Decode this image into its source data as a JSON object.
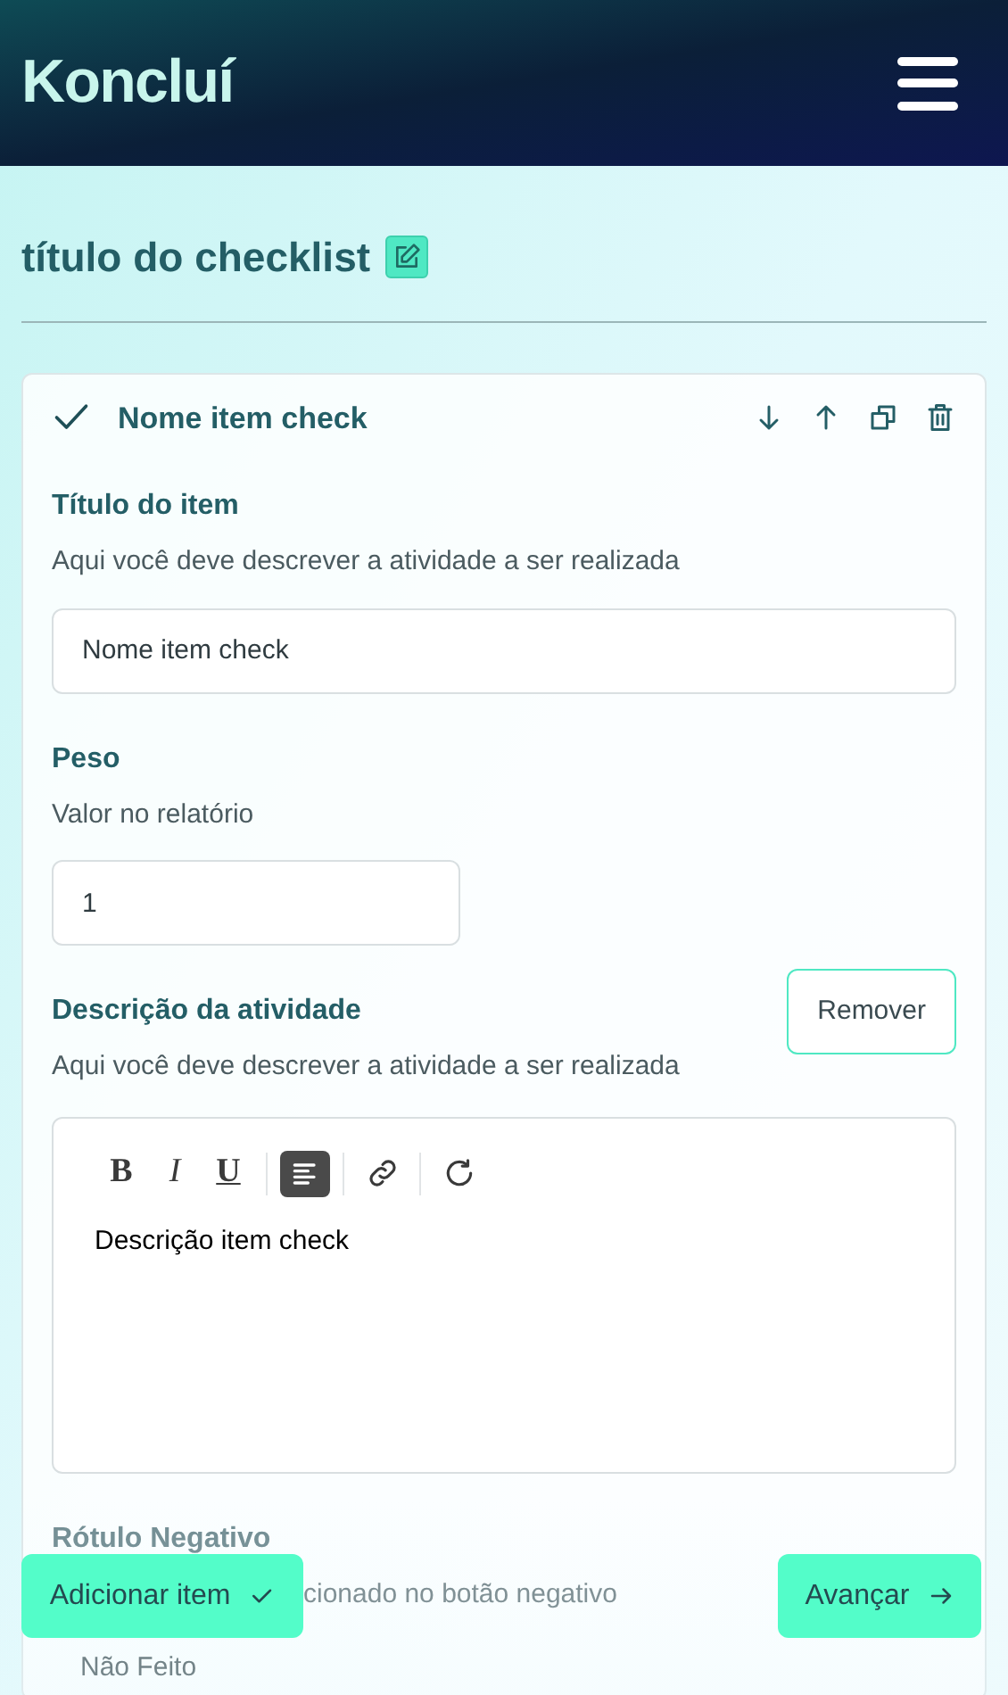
{
  "header": {
    "logo": "Koncluí"
  },
  "page_title": "título do checklist",
  "item": {
    "checked": true,
    "name": "Nome item check",
    "fields": [
      {
        "kind": "text",
        "label": "Título do item",
        "hint": "Aqui você deve descrever a atividade a ser realizada",
        "value": "Nome item check"
      },
      {
        "kind": "number",
        "label": "Peso",
        "hint": "Valor no relatório",
        "value": "1"
      },
      {
        "kind": "editor",
        "label": "Descrição da atividade",
        "hint": "Aqui você deve descrever a atividade a ser realizada",
        "action": "Remover",
        "toolbar": [
          {
            "kind": "bold",
            "label": "B",
            "selected": false
          },
          {
            "kind": "italic",
            "label": "I",
            "selected": false
          },
          {
            "kind": "underline",
            "label": "U",
            "selected": false
          },
          {
            "kind": "align",
            "selected": true
          },
          {
            "kind": "link",
            "selected": false
          },
          {
            "kind": "redo",
            "selected": false
          }
        ],
        "value": "Descrição item check"
      },
      {
        "kind": "faded",
        "label": "Rótulo Negativo",
        "hint": "cionado no botão negativo",
        "value": "Não Feito"
      }
    ]
  },
  "footer": {
    "add_button": "Adicionar item",
    "next_button": "Avançar"
  }
}
